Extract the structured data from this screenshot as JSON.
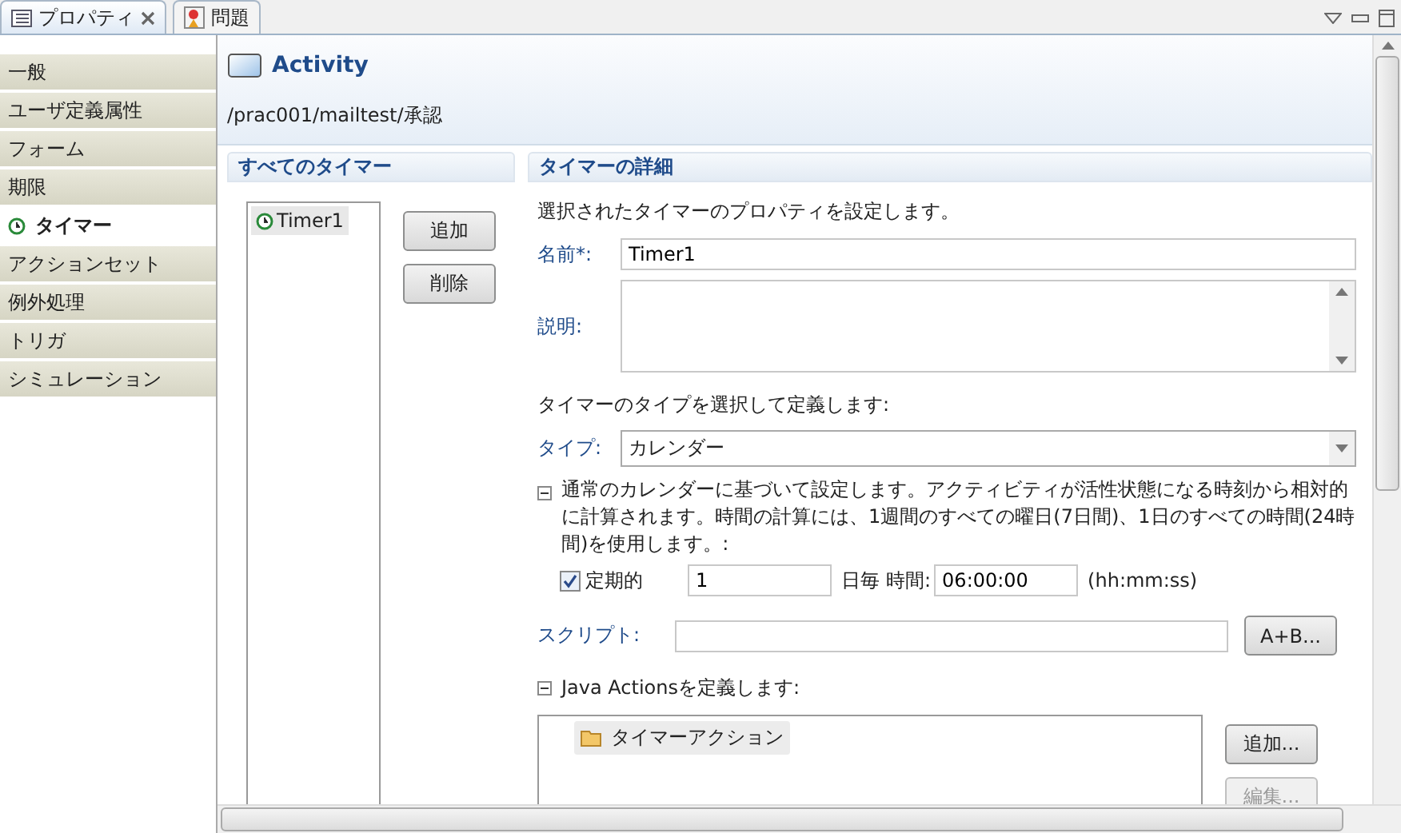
{
  "tabs": [
    {
      "label": "プロパティ",
      "selected": true
    },
    {
      "label": "問題",
      "selected": false
    }
  ],
  "sidebar": {
    "items": [
      {
        "label": "一般",
        "selected": false
      },
      {
        "label": "ユーザ定義属性",
        "selected": false
      },
      {
        "label": "フォーム",
        "selected": false
      },
      {
        "label": "期限",
        "selected": false
      },
      {
        "label": "タイマー",
        "selected": true
      },
      {
        "label": "アクションセット",
        "selected": false
      },
      {
        "label": "例外処理",
        "selected": false
      },
      {
        "label": "トリガ",
        "selected": false
      },
      {
        "label": "シミュレーション",
        "selected": false
      }
    ]
  },
  "header": {
    "title": "Activity",
    "path": "/prac001/mailtest/承認"
  },
  "timers_panel": {
    "title": "すべてのタイマー",
    "timers": [
      {
        "label": "Timer1",
        "selected": true
      }
    ],
    "buttons": [
      "追加",
      "削除"
    ]
  },
  "details": {
    "title": "タイマーの詳細",
    "intro": "選択されたタイマーのプロパティを設定します。",
    "name": {
      "label": "名前*:",
      "value": "Timer1"
    },
    "description": {
      "label": "説明:"
    },
    "type_prompt": "タイマーのタイプを選択して定義します:",
    "type": {
      "label": "タイプ:",
      "value": "カレンダー"
    },
    "calendar_section": {
      "expanded": true,
      "text": "通常のカレンダーに基づいて設定します。アクティビティが活性状態になる時刻から相対的に計算されます。時間の計算には、1週間のすべての曜日(7日間)、1日のすべての時間(24時間)を使用します。:"
    },
    "recurring": {
      "label": "定期的",
      "checked": true,
      "interval": "1",
      "unit": "日毎",
      "time_label": "時間:",
      "time": "06:00:00",
      "format": "(hh:mm:ss)"
    },
    "script": {
      "label": "スクリプト:",
      "button": "A+B..."
    },
    "java_actions": {
      "expanded": true,
      "title": "Java Actionsを定義します:",
      "items": [
        {
          "label": "タイマーアクション"
        }
      ],
      "buttons": [
        {
          "label": "追加...",
          "disabled": false
        },
        {
          "label": "編集...",
          "disabled": true
        }
      ]
    }
  }
}
